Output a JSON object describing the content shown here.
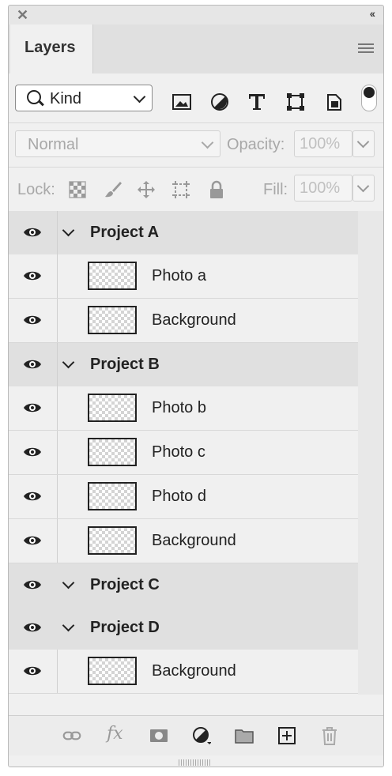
{
  "window": {
    "close_glyph": "✕",
    "collapse_glyph": "‹‹"
  },
  "tabs": [
    {
      "label": "Layers"
    }
  ],
  "filter": {
    "kind_label": "Kind",
    "icons": [
      "image-filter-icon",
      "adjustment-filter-icon",
      "type-filter-icon",
      "shape-filter-icon",
      "smart-object-filter-icon"
    ]
  },
  "blend": {
    "mode": "Normal",
    "opacity_label": "Opacity:",
    "opacity_value": "100%",
    "fill_label": "Fill:",
    "fill_value": "100%"
  },
  "lock": {
    "label": "Lock:",
    "icons": [
      "lock-transparent-icon",
      "lock-paint-icon",
      "lock-move-icon",
      "lock-artboard-icon",
      "lock-all-icon"
    ]
  },
  "layers": [
    {
      "type": "group",
      "name": "Project A"
    },
    {
      "type": "layer",
      "name": "Photo a"
    },
    {
      "type": "layer",
      "name": "Background"
    },
    {
      "type": "group",
      "name": "Project B"
    },
    {
      "type": "layer",
      "name": "Photo b"
    },
    {
      "type": "layer",
      "name": "Photo c"
    },
    {
      "type": "layer",
      "name": "Photo d"
    },
    {
      "type": "layer",
      "name": "Background"
    },
    {
      "type": "group",
      "name": "Project C"
    },
    {
      "type": "group",
      "name": "Project D"
    },
    {
      "type": "layer",
      "name": "Background"
    }
  ],
  "bottom_toolbar": [
    "link-layers-icon",
    "fx-icon",
    "layer-mask-icon",
    "adjustment-layer-icon",
    "new-group-icon",
    "new-layer-icon",
    "trash-icon"
  ],
  "bottom_labels": {
    "fx": "fx"
  },
  "colors": {
    "panel_bg": "#f0f0f0",
    "group_row_bg": "#e0e0e0",
    "tab_strip": "#e0e0e0",
    "text": "#222222",
    "disabled_text": "#a8a8a8"
  }
}
